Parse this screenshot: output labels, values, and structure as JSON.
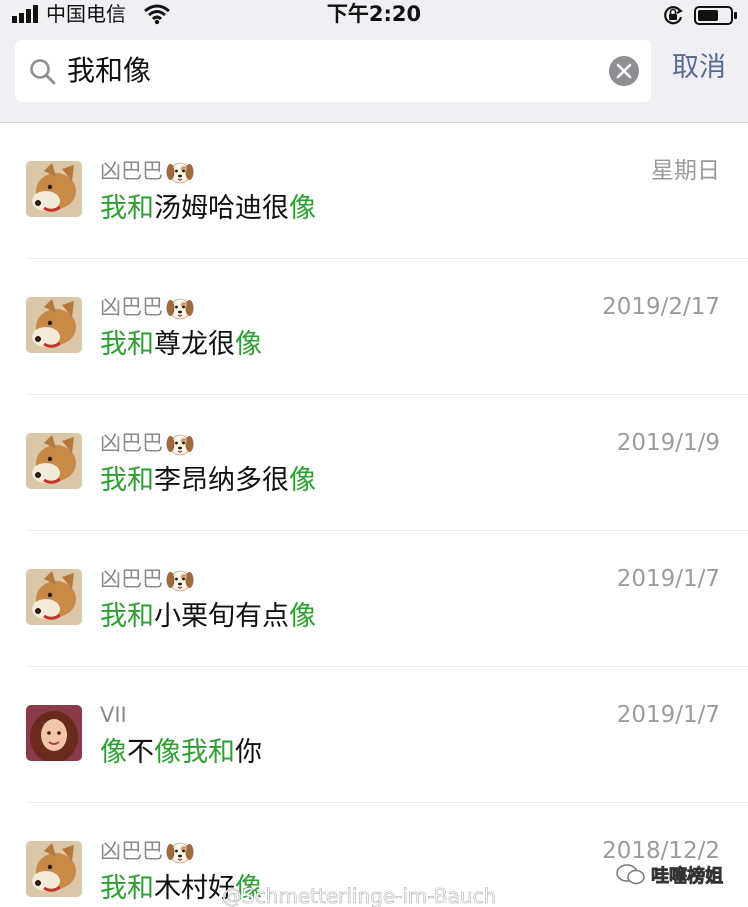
{
  "status_bar": {
    "carrier": "中国电信",
    "time": "下午2:20",
    "icons": [
      "signal-icon",
      "wifi-icon",
      "orientation-lock-icon",
      "battery-icon"
    ]
  },
  "search": {
    "query": "我和像",
    "cancel_label": "取消",
    "icons": [
      "search-icon",
      "clear-icon"
    ]
  },
  "colors": {
    "highlight": "#2e9e32",
    "cancel": "#576b95",
    "header_bg": "#efeff4"
  },
  "results": [
    {
      "sender": "凶巴巴",
      "sender_icon": "dog-emoji",
      "date": "星期日",
      "message": [
        {
          "t": "我和",
          "hl": true
        },
        {
          "t": "汤姆哈迪很",
          "hl": false
        },
        {
          "t": "像",
          "hl": true
        }
      ]
    },
    {
      "sender": "凶巴巴",
      "sender_icon": "dog-emoji",
      "date": "2019/2/17",
      "message": [
        {
          "t": "我和",
          "hl": true
        },
        {
          "t": "尊龙很",
          "hl": false
        },
        {
          "t": "像",
          "hl": true
        }
      ]
    },
    {
      "sender": "凶巴巴",
      "sender_icon": "dog-emoji",
      "date": "2019/1/9",
      "message": [
        {
          "t": "我和",
          "hl": true
        },
        {
          "t": "李昂纳多很",
          "hl": false
        },
        {
          "t": "像",
          "hl": true
        }
      ]
    },
    {
      "sender": "凶巴巴",
      "sender_icon": "dog-emoji",
      "date": "2019/1/7",
      "message": [
        {
          "t": "我和",
          "hl": true
        },
        {
          "t": "小栗旬有点",
          "hl": false
        },
        {
          "t": "像",
          "hl": true
        }
      ]
    },
    {
      "sender": "VII",
      "sender_icon": "",
      "date": "2019/1/7",
      "message": [
        {
          "t": "像",
          "hl": true
        },
        {
          "t": "不",
          "hl": false
        },
        {
          "t": "像我和",
          "hl": true
        },
        {
          "t": "你",
          "hl": false
        }
      ]
    },
    {
      "sender": "凶巴巴",
      "sender_icon": "dog-emoji",
      "date": "2018/12/2",
      "message": [
        {
          "t": "我和",
          "hl": true
        },
        {
          "t": "木村好",
          "hl": false
        },
        {
          "t": "像",
          "hl": true
        }
      ]
    }
  ],
  "watermark": {
    "weibo": "@Schmetterlinge-im-Bauch",
    "brand": "哇噻榜姐"
  }
}
